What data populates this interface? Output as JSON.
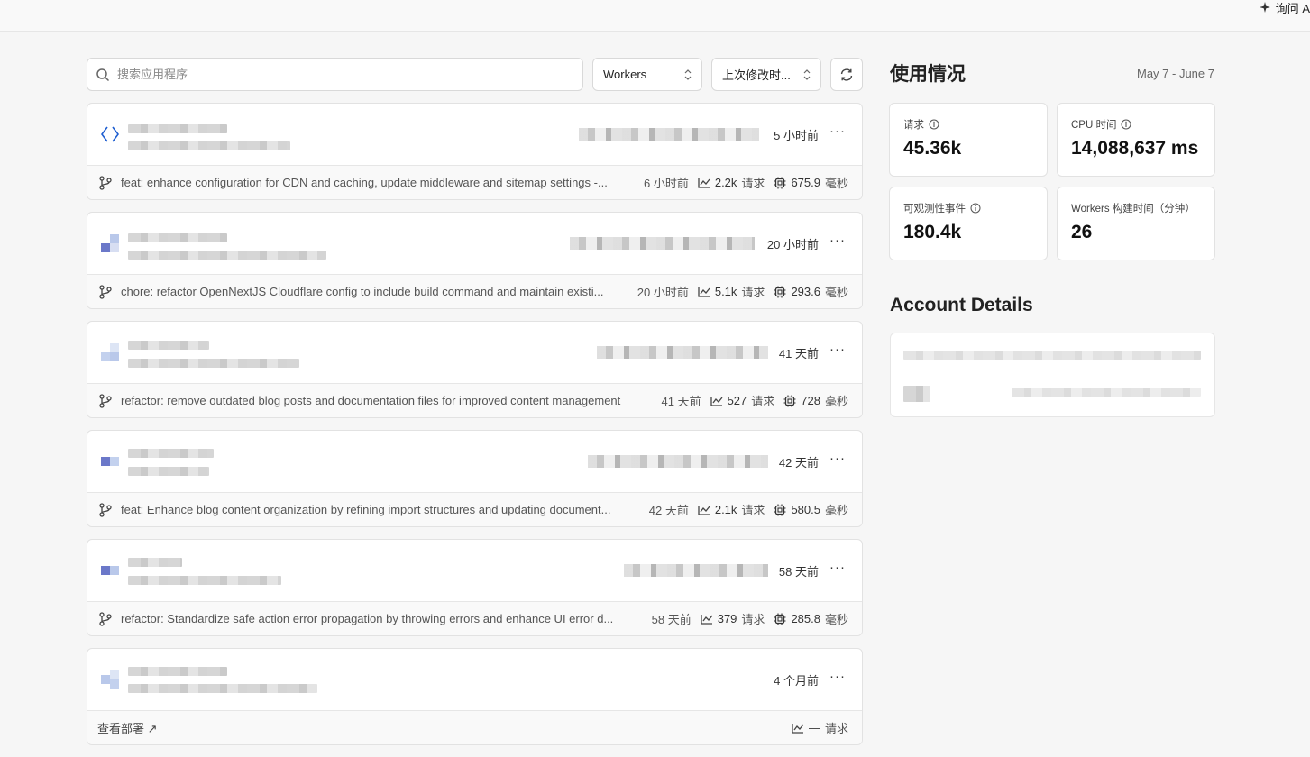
{
  "topbar": {
    "ask_ai_label": "询问 A"
  },
  "toolbar": {
    "search_placeholder": "搜索应用程序",
    "type_select": "Workers",
    "sort_select": "上次修改时..."
  },
  "apps": [
    {
      "time": "5 小时前",
      "commit": "feat: enhance configuration for CDN and caching, update middleware and sitemap settings -...",
      "commit_time": "6 小时前",
      "requests": "2.2k",
      "requests_unit": "请求",
      "cpu": "675.9",
      "cpu_unit": "毫秒"
    },
    {
      "time": "20 小时前",
      "commit": "chore: refactor OpenNextJS Cloudflare config to include build command and maintain existi...",
      "commit_time": "20 小时前",
      "requests": "5.1k",
      "requests_unit": "请求",
      "cpu": "293.6",
      "cpu_unit": "毫秒"
    },
    {
      "time": "41 天前",
      "commit": "refactor: remove outdated blog posts and documentation files for improved content management",
      "commit_time": "41 天前",
      "requests": "527",
      "requests_unit": "请求",
      "cpu": "728",
      "cpu_unit": "毫秒"
    },
    {
      "time": "42 天前",
      "commit": "feat: Enhance blog content organization by refining import structures and updating document...",
      "commit_time": "42 天前",
      "requests": "2.1k",
      "requests_unit": "请求",
      "cpu": "580.5",
      "cpu_unit": "毫秒"
    },
    {
      "time": "58 天前",
      "commit": "refactor: Standardize safe action error propagation by throwing errors and enhance UI error d...",
      "commit_time": "58 天前",
      "requests": "379",
      "requests_unit": "请求",
      "cpu": "285.8",
      "cpu_unit": "毫秒"
    },
    {
      "time": "4 个月前",
      "view_deploy": "查看部署 ↗",
      "requests": "—",
      "requests_unit": "请求"
    }
  ],
  "usage": {
    "title": "使用情况",
    "range": "May 7 - June 7",
    "metrics": [
      {
        "label": "请求",
        "value": "45.36k"
      },
      {
        "label": "CPU 时间",
        "value": "14,088,637 ms"
      },
      {
        "label": "可观测性事件",
        "value": "180.4k"
      },
      {
        "label": "Workers 构建时间（分钟）",
        "value": "26"
      }
    ]
  },
  "account": {
    "title": "Account Details"
  },
  "colors": {
    "accent_blue": "#1f5fd1",
    "icon_blue": "#6b78c9",
    "icon_light": "#b9c8ea"
  }
}
